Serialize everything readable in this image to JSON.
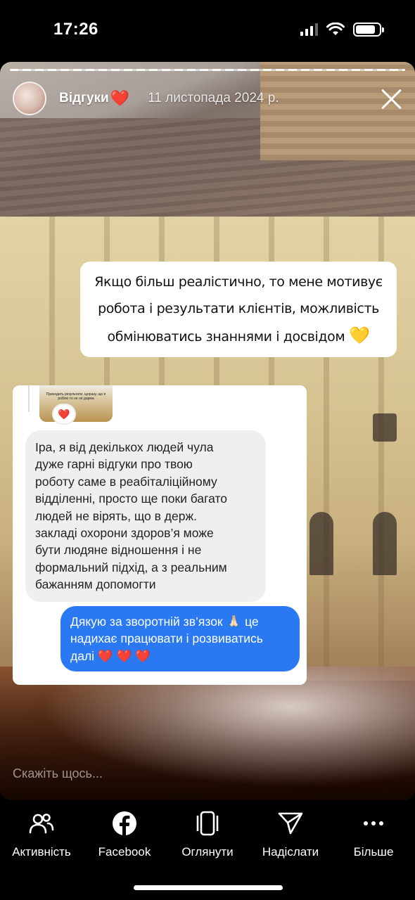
{
  "status_bar": {
    "time": "17:26",
    "battery_level": 0.85
  },
  "story": {
    "title": "Відгуки",
    "title_emoji": "❤️",
    "date": "11 листопада 2024 р.",
    "caption_lines": [
      "Якщо більш реалістично, то мене мотивує",
      "робота і результати клієнтів, можливість",
      "обмінюватись знаннями і досвідом"
    ],
    "caption_emoji": "💛",
    "reply_placeholder": "Скажіть щось..."
  },
  "chat": {
    "thumbnail_text": "Приходить результати, щоразу, що я роблю то не не дарма",
    "incoming_lines": [
      "Іра,  я від декількох людей чула",
      "дуже гарні відгуки про твою",
      "роботу саме в реабіталіційному",
      "відділенні, просто ще поки багато",
      "людей не вірять, що в держ.",
      "закладі охорони здоров’я може",
      "бути людяне відношення і не",
      "формальний підхід, а з реальним",
      "бажанням допомогти"
    ],
    "outgoing_lines": [
      "Дякую за зворотній зв’язок 🙏🏻 це",
      "надихає працювати і розвиватись",
      "далі ❤️ ❤️ ❤️"
    ],
    "reaction": "❤️"
  },
  "actions": [
    {
      "label": "Активність",
      "icon": "activity-icon"
    },
    {
      "label": "Facebook",
      "icon": "facebook-icon"
    },
    {
      "label": "Оглянути",
      "icon": "browse-icon"
    },
    {
      "label": "Надіслати",
      "icon": "send-icon"
    },
    {
      "label": "Більше",
      "icon": "more-icon"
    }
  ],
  "colors": {
    "outgoing_bubble": "#2a79f3",
    "incoming_bubble": "#efefef",
    "heart": "#e0141e"
  }
}
